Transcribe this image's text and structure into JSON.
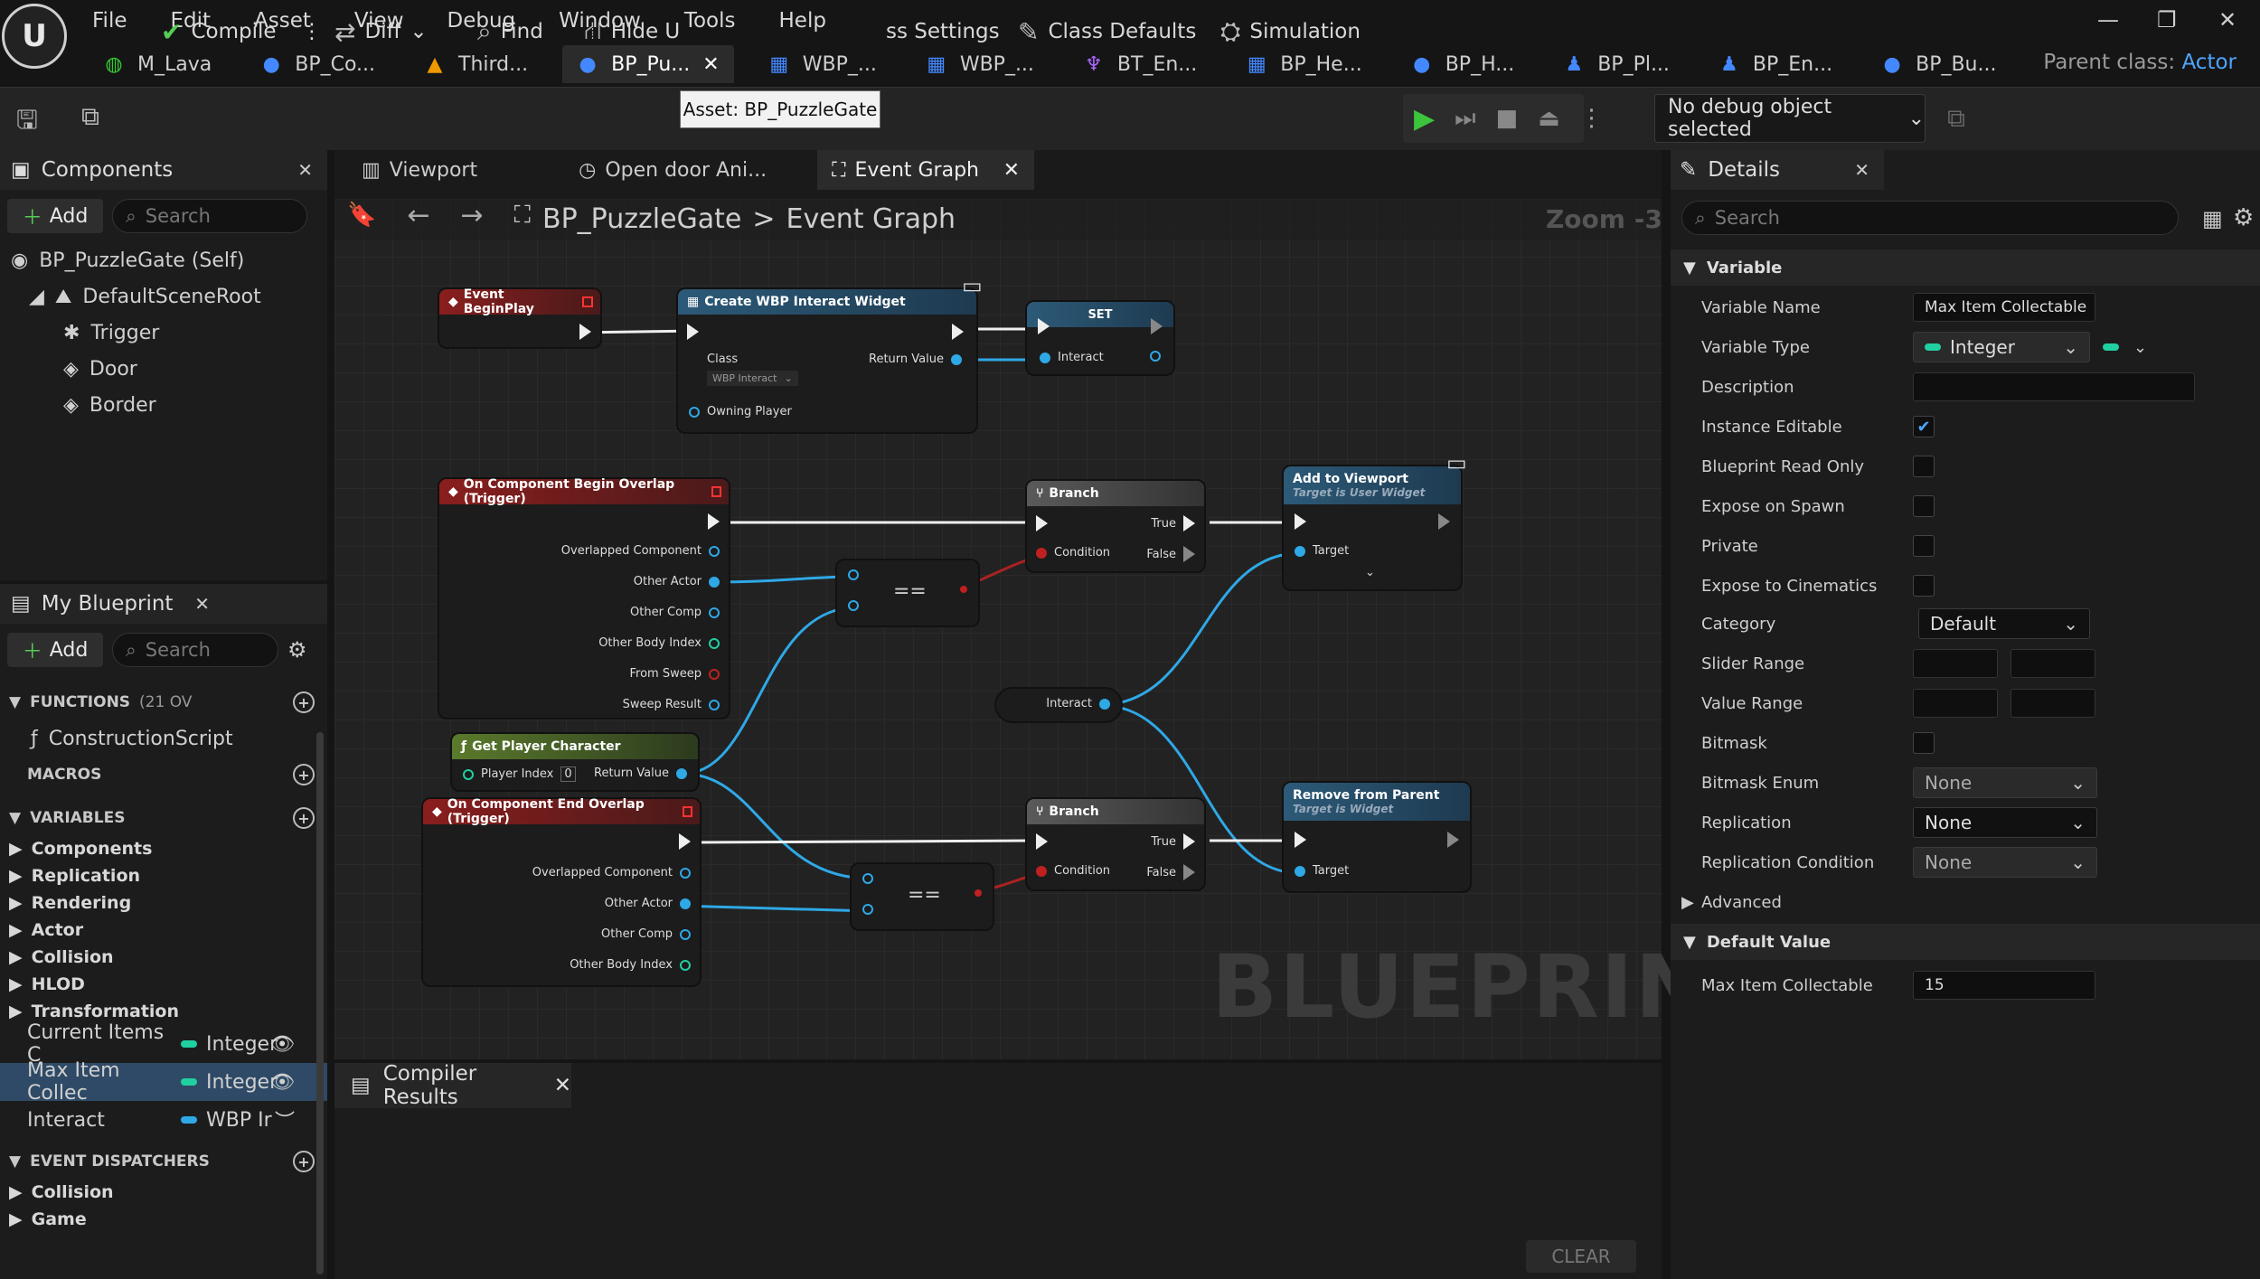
{
  "menu": [
    "File",
    "Edit",
    "Asset",
    "View",
    "Debug",
    "Window",
    "Tools",
    "Help"
  ],
  "doc_tabs": [
    {
      "label": "M_Lava",
      "icon": "material-icon"
    },
    {
      "label": "BP_Co...",
      "icon": "blueprint-icon"
    },
    {
      "label": "Third...",
      "icon": "character-icon"
    },
    {
      "label": "BP_Pu...",
      "icon": "blueprint-icon",
      "active": true
    },
    {
      "label": "WBP_...",
      "icon": "widget-icon"
    },
    {
      "label": "WBP_...",
      "icon": "widget-icon"
    },
    {
      "label": "BT_En...",
      "icon": "behavior-tree-icon"
    },
    {
      "label": "BP_He...",
      "icon": "widget-icon"
    },
    {
      "label": "BP_H...",
      "icon": "blueprint-icon"
    },
    {
      "label": "BP_Pl...",
      "icon": "character-icon"
    },
    {
      "label": "BP_En...",
      "icon": "character-icon"
    },
    {
      "label": "BP_Bu...",
      "icon": "blueprint-icon"
    }
  ],
  "parent_class": {
    "label": "Parent class:",
    "value": "Actor"
  },
  "tooltip": "Asset: BP_PuzzleGate",
  "toolbar": {
    "compile": "Compile",
    "diff": "Diff",
    "find": "Find",
    "hide": "Hide U",
    "settings": "ss Settings",
    "class_defaults": "Class Defaults",
    "simulation": "Simulation",
    "debug_object": "No debug object selected"
  },
  "components": {
    "title": "Components",
    "add": "Add",
    "search": "Search",
    "root": "BP_PuzzleGate (Self)",
    "scene_root": "DefaultSceneRoot",
    "children": [
      "Trigger",
      "Door",
      "Border"
    ]
  },
  "my_blueprint": {
    "title": "My Blueprint",
    "add": "Add",
    "search": "Search",
    "functions_label": "FUNCTIONS",
    "functions_count": "(21 OV",
    "construction": "ConstructionScript",
    "macros": "MACROS",
    "variables": "VARIABLES",
    "categories": [
      "Components",
      "Replication",
      "Rendering",
      "Actor",
      "Collision",
      "HLOD",
      "Transformation"
    ],
    "vars": [
      {
        "name": "Current Items C",
        "type": "Integer"
      },
      {
        "name": "Max Item Collec",
        "type": "Integer"
      },
      {
        "name": "Interact",
        "type": "WBP Ir"
      }
    ],
    "dispatchers": "EVENT DISPATCHERS",
    "dispatcher_cats": [
      "Collision",
      "Game"
    ]
  },
  "graph_tabs": [
    {
      "label": "Viewport"
    },
    {
      "label": "Open door Ani..."
    },
    {
      "label": "Event Graph",
      "active": true
    }
  ],
  "breadcrumb": {
    "root": "BP_PuzzleGate",
    "sep": ">",
    "leaf": "Event Graph"
  },
  "zoom": "Zoom -3",
  "watermark": "BLUEPRINT",
  "nodes": {
    "begin_play": "Event BeginPlay",
    "create_widget": "Create WBP Interact Widget",
    "class_pin": "Class",
    "class_val": "WBP Interact",
    "return_value": "Return Value",
    "owning_player": "Owning Player",
    "set": "SET",
    "interact": "Interact",
    "begin_overlap": "On Component Begin Overlap (Trigger)",
    "overlapped": "Overlapped Component",
    "other_actor": "Other Actor",
    "other_comp": "Other Comp",
    "other_body": "Other Body Index",
    "from_sweep": "From Sweep",
    "sweep_result": "Sweep Result",
    "equals": "==",
    "branch": "Branch",
    "true": "True",
    "false": "False",
    "condition": "Condition",
    "add_viewport": "Add to Viewport",
    "add_viewport_sub": "Target is User Widget",
    "target": "Target",
    "interact_var": "Interact",
    "get_player": "Get Player Character",
    "player_index": "Player Index",
    "player_index_val": "0",
    "end_overlap": "On Component End Overlap (Trigger)",
    "remove_parent": "Remove from Parent",
    "remove_sub": "Target is Widget"
  },
  "compiler": {
    "title": "Compiler Results",
    "clear": "CLEAR"
  },
  "details": {
    "title": "Details",
    "search": "Search",
    "variable_section": "Variable",
    "rows": {
      "var_name_label": "Variable Name",
      "var_name": "Max Item Collectable",
      "var_type_label": "Variable Type",
      "var_type": "Integer",
      "description": "Description",
      "instance_editable": "Instance Editable",
      "bp_read_only": "Blueprint Read Only",
      "expose_spawn": "Expose on Spawn",
      "private": "Private",
      "expose_cinematics": "Expose to Cinematics",
      "category_label": "Category",
      "category": "Default",
      "slider_range": "Slider Range",
      "value_range": "Value Range",
      "bitmask": "Bitmask",
      "bitmask_enum_label": "Bitmask Enum",
      "bitmask_enum": "None",
      "replication_label": "Replication",
      "replication": "None",
      "rep_cond_label": "Replication Condition",
      "rep_cond": "None",
      "advanced": "Advanced",
      "default_value": "Default Value",
      "max_item_label": "Max Item Collectable",
      "max_item": "15"
    }
  },
  "colors": {
    "accent": "#4fa4ff",
    "integer": "#20d0a0",
    "object": "#2fa8e6",
    "event": "#8a1e1e",
    "play": "#3cc43c"
  }
}
